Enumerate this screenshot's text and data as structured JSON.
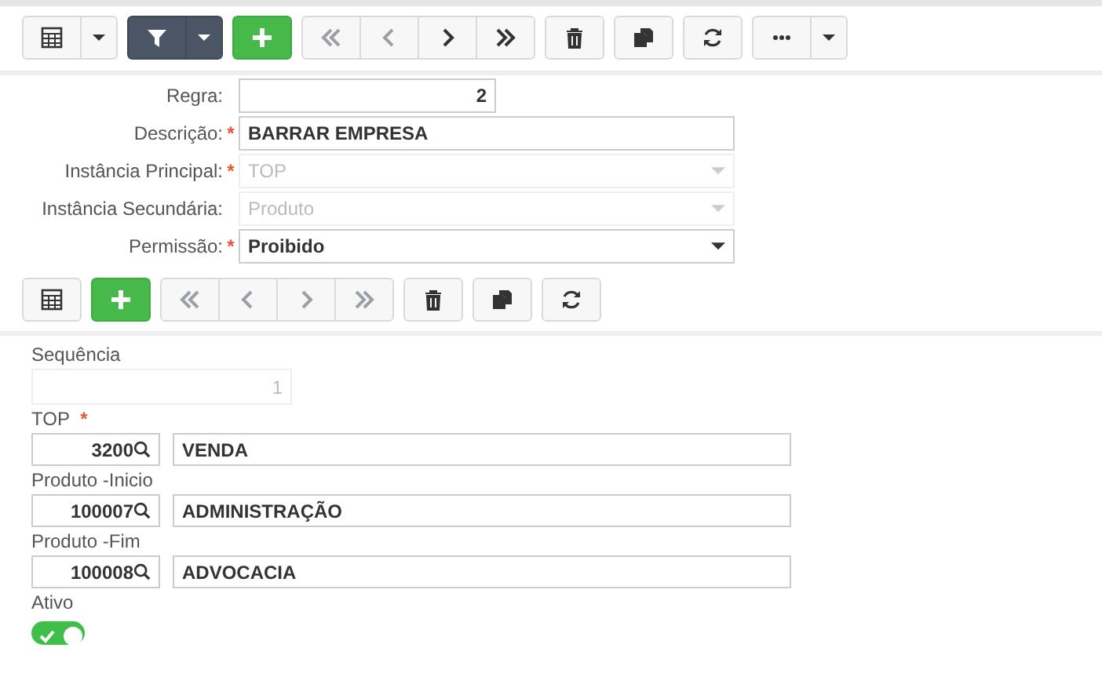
{
  "main_toolbar": {
    "groups": [
      {
        "buttons": [
          {
            "kind": "grid",
            "disabled": false
          },
          {
            "kind": "dropdown",
            "disabled": false
          }
        ]
      },
      {
        "buttons": [
          {
            "kind": "filter",
            "disabled": false
          },
          {
            "kind": "filter-dropdown",
            "disabled": false
          }
        ]
      },
      {
        "buttons": [
          {
            "kind": "add",
            "disabled": false
          }
        ]
      },
      {
        "buttons": [
          {
            "kind": "first",
            "disabled": true
          },
          {
            "kind": "previous",
            "disabled": true
          },
          {
            "kind": "next",
            "disabled": false
          },
          {
            "kind": "last",
            "disabled": false
          }
        ]
      },
      {
        "buttons": [
          {
            "kind": "delete",
            "disabled": false
          }
        ]
      },
      {
        "buttons": [
          {
            "kind": "copy",
            "disabled": false
          }
        ]
      },
      {
        "buttons": [
          {
            "kind": "refresh",
            "disabled": false
          }
        ]
      },
      {
        "buttons": [
          {
            "kind": "more",
            "disabled": false
          },
          {
            "kind": "dropdown",
            "disabled": false
          }
        ]
      }
    ]
  },
  "header_form": {
    "fields": [
      {
        "label": "Regra:",
        "kind": "number",
        "value": "2",
        "disabled": false
      },
      {
        "label": "Descrição:",
        "required_mark": "*",
        "kind": "text",
        "value": "BARRAR EMPRESA",
        "disabled": false
      },
      {
        "label": "Instância Principal:",
        "required_mark": "*",
        "kind": "select",
        "value": "TOP",
        "disabled": true
      },
      {
        "label": "Instância Secundária:",
        "kind": "select",
        "value": "Produto",
        "disabled": true
      },
      {
        "label": "Permissão:",
        "required_mark": "*",
        "kind": "select",
        "value": "Proibido",
        "disabled": false
      }
    ]
  },
  "detail_toolbar": {
    "groups": [
      {
        "buttons": [
          {
            "kind": "grid",
            "disabled": false
          }
        ]
      },
      {
        "buttons": [
          {
            "kind": "add",
            "disabled": false
          }
        ]
      },
      {
        "buttons": [
          {
            "kind": "first",
            "disabled": true
          },
          {
            "kind": "previous",
            "disabled": true
          },
          {
            "kind": "next",
            "disabled": true
          },
          {
            "kind": "last",
            "disabled": true
          }
        ]
      },
      {
        "buttons": [
          {
            "kind": "delete",
            "disabled": false
          }
        ]
      },
      {
        "buttons": [
          {
            "kind": "copy",
            "disabled": false
          }
        ]
      },
      {
        "buttons": [
          {
            "kind": "refresh",
            "disabled": false
          }
        ]
      }
    ]
  },
  "detail_form": {
    "fields": [
      {
        "kind": "number",
        "label": "Sequência",
        "value": "1",
        "disabled": true
      },
      {
        "kind": "lookup",
        "label": "TOP",
        "required_mark": "*",
        "code": "3200",
        "description": "VENDA"
      },
      {
        "kind": "lookup",
        "label": "Produto -Inicio",
        "code": "100007",
        "description": "ADMINISTRAÇÃO"
      },
      {
        "kind": "lookup",
        "label": "Produto -Fim",
        "code": "100008",
        "description": "ADVOCACIA"
      },
      {
        "kind": "toggle",
        "label": "Ativo",
        "on": true
      }
    ]
  }
}
